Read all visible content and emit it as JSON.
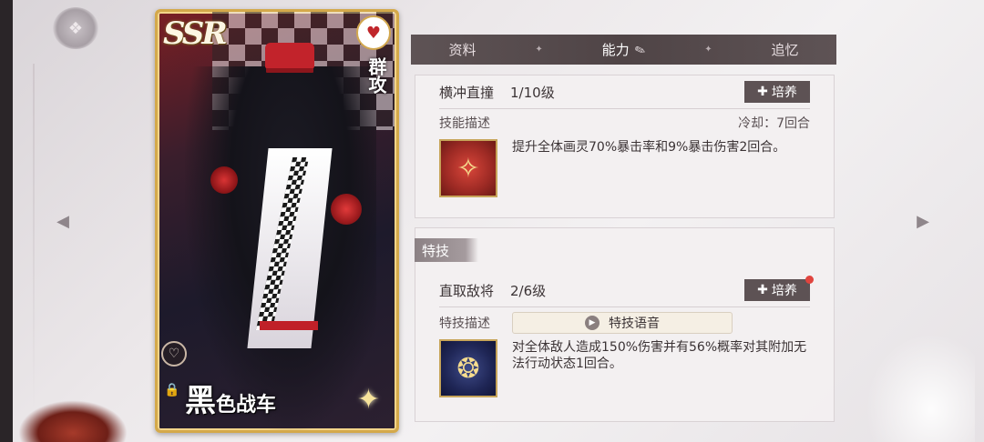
{
  "card": {
    "rarity": "SSR",
    "attack_type": "群攻",
    "name_first": "黑",
    "name_rest": "色战车",
    "icons": [
      "heart-pulse-icon",
      "heart-icon",
      "lock-icon",
      "sparkle-icon"
    ]
  },
  "tabs": [
    {
      "label": "资料",
      "active": false
    },
    {
      "label": "能力",
      "active": true
    },
    {
      "label": "追忆",
      "active": false
    }
  ],
  "skill": {
    "name": "横冲直撞",
    "level": "1/10级",
    "train_label": "培养",
    "desc_label": "技能描述",
    "cooldown": "冷却：7回合",
    "description": "提升全体画灵70%暴击率和9%暴击伤害2回合。"
  },
  "special": {
    "tag": "特技",
    "name": "直取敌将",
    "level": "2/6级",
    "train_label": "培养",
    "desc_label": "特技描述",
    "voice_label": "特技语音",
    "description": "对全体敌人造成150%伤害并有56%概率对其附加无法行动状态1回合。"
  },
  "colors": {
    "tab_bar": "#4f4446",
    "button": "#5d5254",
    "card_border": "#d4a94a",
    "notif_dot": "#e0443e"
  }
}
